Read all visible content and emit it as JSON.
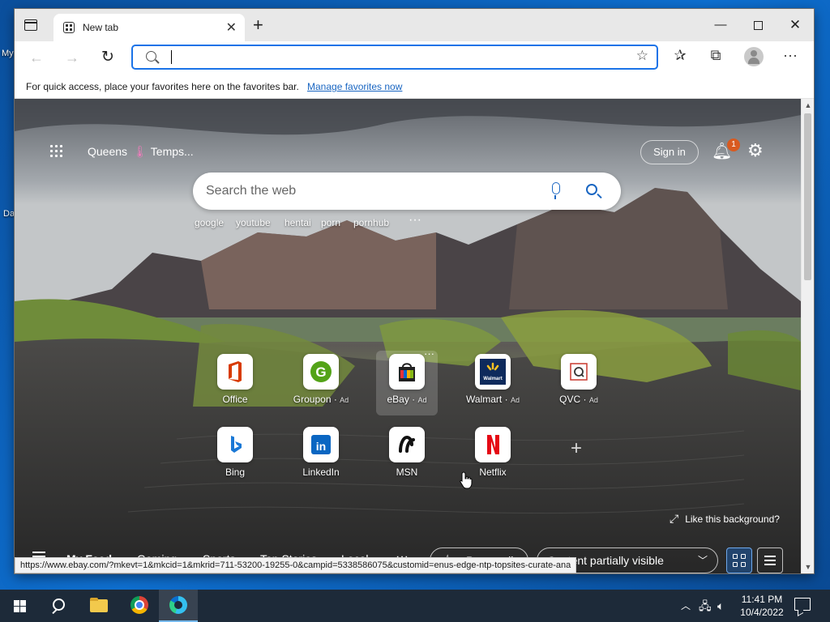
{
  "desktop": {
    "labels": [
      "My",
      "Da"
    ]
  },
  "browser": {
    "tab_title": "New tab",
    "address_value": "",
    "favbar_text": "For quick access, place your favorites here on the favorites bar.",
    "favbar_link": "Manage favorites now"
  },
  "ntp": {
    "location": "Queens",
    "temperature": "Temps...",
    "sign_in": "Sign in",
    "notification_count": "1",
    "search_placeholder": "Search the web",
    "trending": [
      "google",
      "youtube",
      "hentai",
      "porn",
      "pornhub"
    ],
    "tiles": [
      {
        "label": "Office",
        "ad": "",
        "icon": "office-icon"
      },
      {
        "label": "Groupon",
        "ad": "Ad",
        "icon": "groupon-icon"
      },
      {
        "label": "eBay",
        "ad": "Ad",
        "icon": "ebay-icon"
      },
      {
        "label": "Walmart",
        "ad": "Ad",
        "icon": "walmart-icon"
      },
      {
        "label": "QVC",
        "ad": "Ad",
        "icon": "qvc-icon"
      },
      {
        "label": "Bing",
        "ad": "",
        "icon": "bing-icon"
      },
      {
        "label": "LinkedIn",
        "ad": "",
        "icon": "linkedin-icon"
      },
      {
        "label": "MSN",
        "ad": "",
        "icon": "msn-icon"
      },
      {
        "label": "Netflix",
        "ad": "",
        "icon": "netflix-icon"
      }
    ],
    "like_background": "Like this background?",
    "feed_tabs": [
      "My Feed",
      "Gaming",
      "Sports",
      "Top Stories",
      "Local"
    ],
    "personalize": "Personalize",
    "content_visibility": "Content partially visible"
  },
  "status_url": "https://www.ebay.com/?mkevt=1&mkcid=1&mkrid=711-53200-19255-0&campid=5338586075&customid=enus-edge-ntp-topsites-curate-ana",
  "taskbar": {
    "time": "11:41 PM",
    "date": "10/4/2022"
  },
  "colors": {
    "accent": "#1a66c2",
    "address_border": "#1a73e8",
    "badge": "#d85a20"
  }
}
